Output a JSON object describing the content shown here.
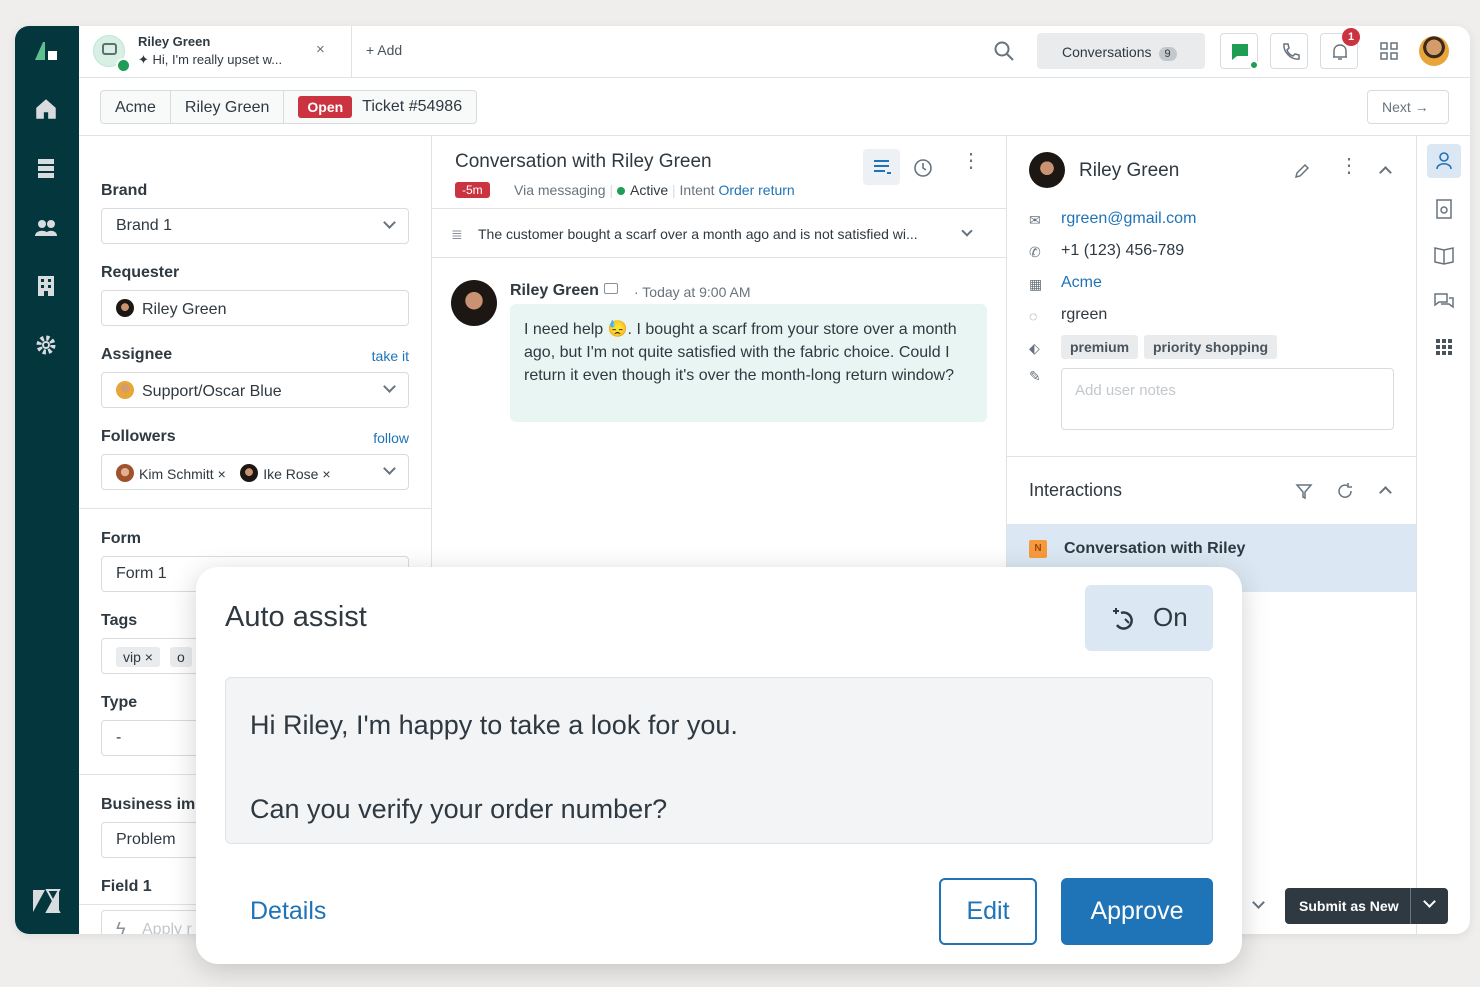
{
  "topbar": {
    "tab": {
      "name": "Riley Green",
      "snippet": "Hi, I'm really upset w...",
      "close": "×"
    },
    "add_label": "+ Add",
    "conversations_label": "Conversations",
    "conversations_count": "9",
    "notifications_count": "1"
  },
  "breadcrumb": {
    "org": "Acme",
    "requester": "Riley Green",
    "status": "Open",
    "ticket": "Ticket #54986"
  },
  "next_label": "Next →",
  "ticket_fields": {
    "brand_label": "Brand",
    "brand_value": "Brand 1",
    "requester_label": "Requester",
    "requester_value": "Riley Green",
    "assignee_label": "Assignee",
    "assignee_link": "take it",
    "assignee_value": "Support/Oscar Blue",
    "followers_label": "Followers",
    "followers_link": "follow",
    "followers": [
      "Kim Schmitt ×",
      "Ike Rose ×"
    ],
    "form_label": "Form",
    "form_value": "Form 1",
    "tags_label": "Tags",
    "tags": [
      "vip ×",
      "o"
    ],
    "type_label": "Type",
    "type_value": "-",
    "business_label": "Business im",
    "business_value": "Problem",
    "field1_label": "Field 1",
    "apply_macro": "Apply r"
  },
  "conversation": {
    "title": "Conversation with Riley Green",
    "badge": "-5m",
    "channel": "Via messaging",
    "state": "Active",
    "intent_label": "Intent",
    "intent_value": "Order return",
    "summary": "The customer bought a scarf over a month ago and is not satisfied wi...",
    "message": {
      "author": "Riley Green",
      "time": "· Today at 9:00 AM",
      "body": "I need help 😓. I bought a scarf from your store over a month ago, but I'm not quite satisfied with the fabric choice. Could I return it even though it's over the month-long return window?"
    }
  },
  "customer": {
    "name": "Riley Green",
    "email": "rgreen@gmail.com",
    "phone": "+1 (123) 456-789",
    "org": "Acme",
    "handle": "rgreen",
    "tags": [
      "premium",
      "priority shopping"
    ],
    "notes_placeholder": "Add user notes"
  },
  "interactions": {
    "title": "Interactions",
    "item_badge": "N",
    "item_title": "Conversation with Riley"
  },
  "submit_label": "Submit as New",
  "auto_assist": {
    "title": "Auto assist",
    "toggle_label": "On",
    "suggestion_line1": "Hi Riley, I'm happy to take a look for you.",
    "suggestion_line2": "Can you verify your order number?",
    "details_label": "Details",
    "edit_label": "Edit",
    "approve_label": "Approve"
  },
  "colors": {
    "rail": "#03363d",
    "accent_blue": "#1f73b7",
    "open_red": "#cc3340",
    "active_green": "#1f9d55"
  }
}
